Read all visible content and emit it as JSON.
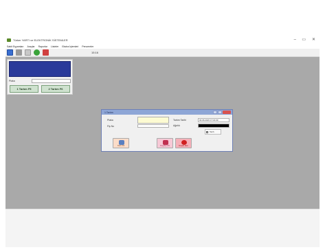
{
  "window": {
    "title": "Türker YARTI ve ELEKTRONİK SİSTEMLER",
    "controls": {
      "minimize": "–",
      "maximize": "▭",
      "close": "✕"
    }
  },
  "menu": {
    "items": [
      "Sabit Eşyamları",
      "Araçlar",
      "Raporlar",
      "Listeler",
      "Ekstra İşlemleri",
      "Pencereler"
    ]
  },
  "toolbar": {
    "icons": [
      "screen-icon",
      "print-icon",
      "edit-icon",
      "arrow-icon",
      "scale-icon"
    ],
    "clock": "15:16"
  },
  "panel": {
    "plaka_label": "Plaka",
    "btn1": "1 Tartım F5",
    "btn2": "2 Tartım F6"
  },
  "dialog": {
    "title": "1.Tartım",
    "labels": {
      "plaka": "Plaka",
      "fis_no": "Fiş No",
      "tartim_tarihi": "Tartım Tarihi",
      "agirlik": "Ağırlık"
    },
    "values": {
      "tartim_tarihi": "03.06.2015 17:16:00"
    },
    "checkbox_label": "Tarih",
    "buttons": {
      "tarti": "Tartı F3",
      "kaydet": "Kaydet F5",
      "kapat": "Kapat Esc"
    }
  }
}
